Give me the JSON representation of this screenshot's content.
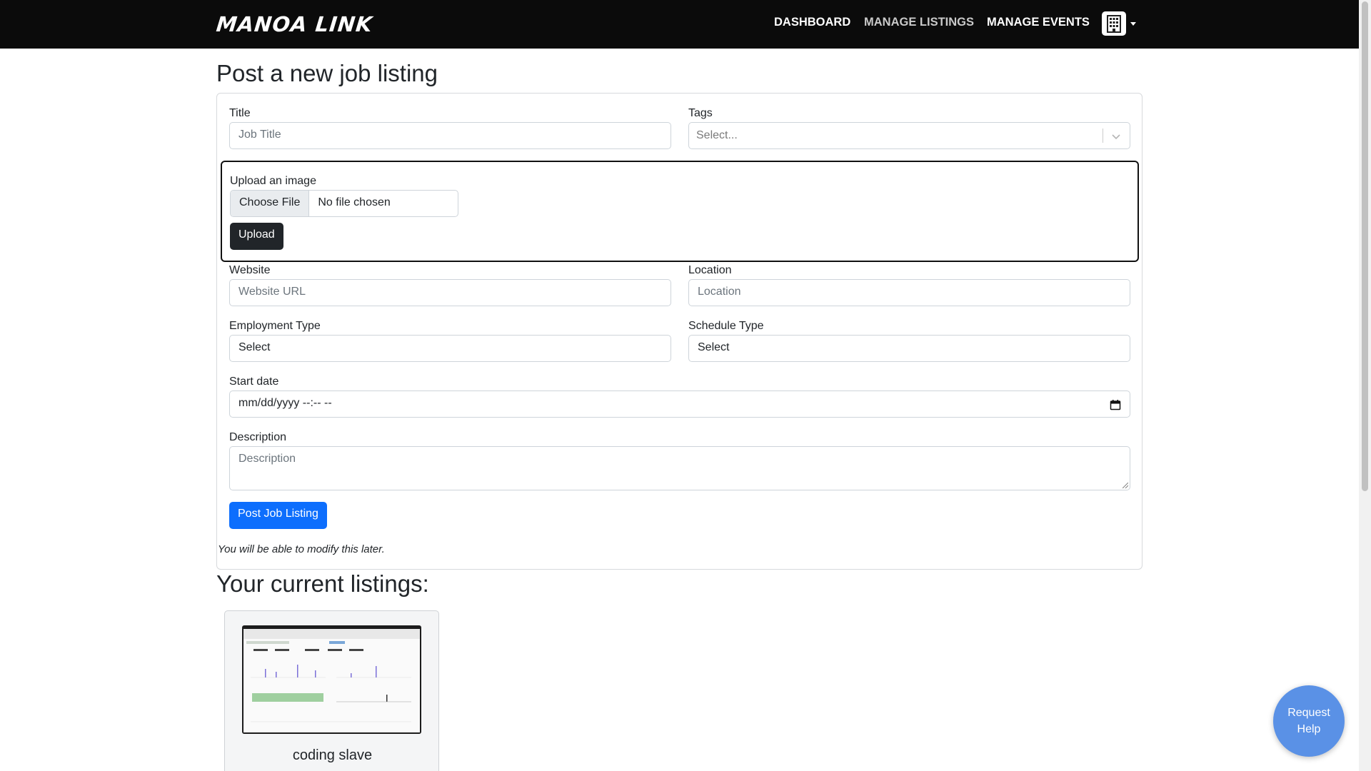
{
  "navbar": {
    "brand": "MANOA LINK",
    "links": [
      "DASHBOARD",
      "MANAGE LISTINGS",
      "MANAGE EVENTS"
    ],
    "org_icon": "building-icon",
    "caret_icon": "caret-down-icon"
  },
  "form": {
    "heading": "Post a new job listing",
    "title_label": "Title",
    "title_placeholder": "Job Title",
    "tags_label": "Tags",
    "tags_placeholder": "Select...",
    "upload_label": "Upload an image",
    "file_button": "Choose File",
    "file_status": "No file chosen",
    "upload_button": "Upload",
    "website_label": "Website",
    "website_placeholder": "Website URL",
    "location_label": "Location",
    "location_placeholder": "Location",
    "employment_label": "Employment Type",
    "employment_value": "Select",
    "schedule_label": "Schedule Type",
    "schedule_value": "Select",
    "start_label": "Start date",
    "start_value": "mm/dd/yyyy --:-- --",
    "description_label": "Description",
    "description_placeholder": "Description",
    "submit_button": "Post Job Listing",
    "note": "You will be able to modify this later."
  },
  "listings": {
    "heading": "Your current listings:",
    "items": [
      {
        "title": "coding slave"
      }
    ]
  },
  "help": {
    "line1": "Request",
    "line2": "Help"
  },
  "colors": {
    "navbar_bg": "#0b0b0b",
    "primary": "#0d6efd",
    "dark_button": "#212529",
    "help_bubble": "#5a91e6"
  }
}
